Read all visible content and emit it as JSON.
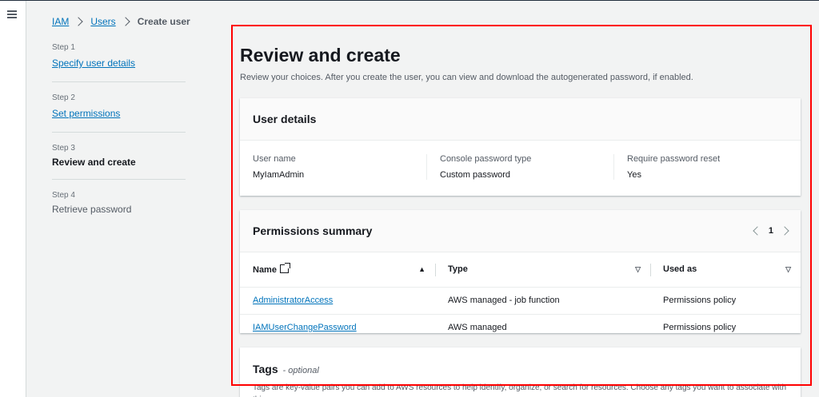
{
  "breadcrumb": {
    "items": [
      "IAM",
      "Users",
      "Create user"
    ]
  },
  "steps": [
    {
      "num": "Step 1",
      "label": "Specify user details"
    },
    {
      "num": "Step 2",
      "label": "Set permissions"
    },
    {
      "num": "Step 3",
      "label": "Review and create"
    },
    {
      "num": "Step 4",
      "label": "Retrieve password"
    }
  ],
  "main": {
    "title": "Review and create",
    "description": "Review your choices. After you create the user, you can view and download the autogenerated password, if enabled."
  },
  "user_details": {
    "title": "User details",
    "fields": [
      {
        "label": "User name",
        "value": "MyIamAdmin"
      },
      {
        "label": "Console password type",
        "value": "Custom password"
      },
      {
        "label": "Require password reset",
        "value": "Yes"
      }
    ]
  },
  "permissions": {
    "title": "Permissions summary",
    "page": "1",
    "columns": [
      "Name",
      "Type",
      "Used as"
    ],
    "rows": [
      {
        "name": "AdministratorAccess",
        "type": "AWS managed - job function",
        "used_as": "Permissions policy"
      },
      {
        "name": "IAMUserChangePassword",
        "type": "AWS managed",
        "used_as": "Permissions policy"
      }
    ]
  },
  "tags": {
    "title": "Tags",
    "optional": "- optional",
    "description": "Tags are key-value pairs you can add to AWS resources to help identify, organize, or search for resources. Choose any tags you want to associate with this user."
  },
  "colors": {
    "link": "#0073bb",
    "highlight": "#ff0000",
    "text": "#16191f"
  }
}
